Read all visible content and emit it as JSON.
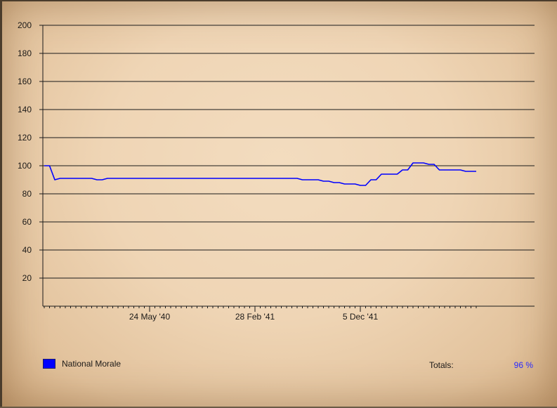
{
  "chart_data": {
    "type": "line",
    "ylim": [
      0,
      200
    ],
    "y_ticks": [
      20,
      40,
      60,
      80,
      100,
      120,
      140,
      160,
      180,
      200
    ],
    "grid": true,
    "x_tick_labels": [
      {
        "label": "24 May '40",
        "index": 20
      },
      {
        "label": "28 Feb '41",
        "index": 40
      },
      {
        "label": "5 Dec '41",
        "index": 60
      }
    ],
    "series": [
      {
        "name": "National Morale",
        "color": "#0000ff",
        "values": [
          100,
          100,
          90,
          91,
          91,
          91,
          91,
          91,
          91,
          91,
          90,
          90,
          91,
          91,
          91,
          91,
          91,
          91,
          91,
          91,
          91,
          91,
          91,
          91,
          91,
          91,
          91,
          91,
          91,
          91,
          91,
          91,
          91,
          91,
          91,
          91,
          91,
          91,
          91,
          91,
          91,
          91,
          91,
          91,
          91,
          91,
          91,
          91,
          91,
          90,
          90,
          90,
          90,
          89,
          89,
          88,
          88,
          87,
          87,
          87,
          86,
          86,
          90,
          90,
          94,
          94,
          94,
          94,
          97,
          97,
          102,
          102,
          102,
          101,
          101,
          97,
          97,
          97,
          97,
          97,
          96,
          96,
          96
        ]
      }
    ]
  },
  "legend": {
    "label": "National Morale",
    "color": "#0000ff"
  },
  "totals": {
    "label": "Totals:",
    "value": "96 %"
  }
}
